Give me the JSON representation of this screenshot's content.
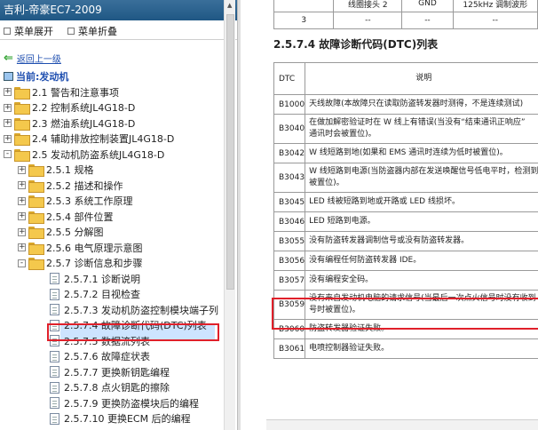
{
  "window_title": "吉利-帝豪EC7-2009",
  "toolbar": {
    "expand_label": "菜单展开",
    "collapse_label": "菜单折叠"
  },
  "nav": {
    "back_label": "返回上一级",
    "current_label": "当前:发动机",
    "items": [
      {
        "label": "2.1 警告和注意事项",
        "level": 0,
        "type": "folder",
        "toggle": "+"
      },
      {
        "label": "2.2 控制系统JL4G18-D",
        "level": 0,
        "type": "folder",
        "toggle": "+"
      },
      {
        "label": "2.3 燃油系统JL4G18-D",
        "level": 0,
        "type": "folder",
        "toggle": "+"
      },
      {
        "label": "2.4 辅助排放控制装置JL4G18-D",
        "level": 0,
        "type": "folder",
        "toggle": "+"
      },
      {
        "label": "2.5 发动机防盗系统JL4G18-D",
        "level": 0,
        "type": "folder",
        "toggle": "-"
      },
      {
        "label": "2.5.1 规格",
        "level": 1,
        "type": "folder",
        "toggle": "+"
      },
      {
        "label": "2.5.2 描述和操作",
        "level": 1,
        "type": "folder",
        "toggle": "+"
      },
      {
        "label": "2.5.3 系统工作原理",
        "level": 1,
        "type": "folder",
        "toggle": "+"
      },
      {
        "label": "2.5.4 部件位置",
        "level": 1,
        "type": "folder",
        "toggle": "+"
      },
      {
        "label": "2.5.5 分解图",
        "level": 1,
        "type": "folder",
        "toggle": "+"
      },
      {
        "label": "2.5.6 电气原理示意图",
        "level": 1,
        "type": "folder",
        "toggle": "+"
      },
      {
        "label": "2.5.7 诊断信息和步骤",
        "level": 1,
        "type": "folder",
        "toggle": "-"
      },
      {
        "label": "2.5.7.1 诊断说明",
        "level": 2,
        "type": "doc"
      },
      {
        "label": "2.5.7.2 目视检查",
        "level": 2,
        "type": "doc"
      },
      {
        "label": "2.5.7.3 发动机防盗控制模块端子列",
        "level": 2,
        "type": "doc"
      },
      {
        "label": "2.5.7.4 故障诊断代码(DTC)列表",
        "level": 2,
        "type": "doc",
        "selected": true
      },
      {
        "label": "2.5.7.5 数据流列表",
        "level": 2,
        "type": "doc"
      },
      {
        "label": "2.5.7.6 故障症状表",
        "level": 2,
        "type": "doc"
      },
      {
        "label": "2.5.7.7 更换新钥匙编程",
        "level": 2,
        "type": "doc"
      },
      {
        "label": "2.5.7.8 点火钥匙的擦除",
        "level": 2,
        "type": "doc"
      },
      {
        "label": "2.5.7.9 更换防盗模块后的编程",
        "level": 2,
        "type": "doc"
      },
      {
        "label": "2.5.7.10 更换ECM 后的编程",
        "level": 2,
        "type": "doc"
      }
    ]
  },
  "content": {
    "top_table": [
      {
        "no": "",
        "c1": "线圈接头 2",
        "c2": "GND",
        "c3": "125kHz 调制波形"
      },
      {
        "no": "3",
        "c1": "--",
        "c2": "--",
        "c3": "--"
      }
    ],
    "section_title": "2.5.7.4 故障诊断代码(DTC)列表",
    "table_headers": {
      "code": "DTC",
      "desc": "说明"
    },
    "rows": [
      {
        "code": "B1000",
        "desc": [
          "天线故障(本故障只在读取防盗转发器时测得，不是连续测试)"
        ]
      },
      {
        "code": "B3040",
        "desc": [
          "在做加解密验证时在 W 线上有错误(当没有“结束通讯正响应”",
          "通讯时会被置位)。"
        ]
      },
      {
        "code": "B3042",
        "desc": [
          "W 线短路到地(如果和 EMS 通讯时连续为低时被置位)。"
        ]
      },
      {
        "code": "B3043",
        "desc": [
          "W 线短路到电源(当防盗器内部在发送唤醒信号低电平时，检测到",
          "被置位)。"
        ]
      },
      {
        "code": "B3045",
        "desc": [
          "LED 线被短路到地或开路或 LED 线损坏。"
        ]
      },
      {
        "code": "B3046",
        "desc": [
          "LED 短路到电源。"
        ]
      },
      {
        "code": "B3055",
        "desc": [
          "没有防盗转发器调制信号或没有防盗转发器。"
        ]
      },
      {
        "code": "B3056",
        "desc": [
          "没有编程任何防盗转发器 IDE。"
        ]
      },
      {
        "code": "B3057",
        "desc": [
          "没有编程安全码。"
        ]
      },
      {
        "code": "B3059",
        "desc": [
          "没有来自发动机电脑的请求信号(当最后一次点火信号时没有收到",
          "号时被置位)。"
        ],
        "highlighted": true
      },
      {
        "code": "B3060",
        "desc": [
          "防盗转发器验证失败。"
        ]
      },
      {
        "code": "B3061",
        "desc": [
          "电喷控制器验证失败。"
        ]
      }
    ]
  },
  "colors": {
    "title_bar": "#1f5784",
    "highlight_border": "#e0202a",
    "link": "#1f4fb0",
    "selected_bg": "#cde4ff"
  }
}
